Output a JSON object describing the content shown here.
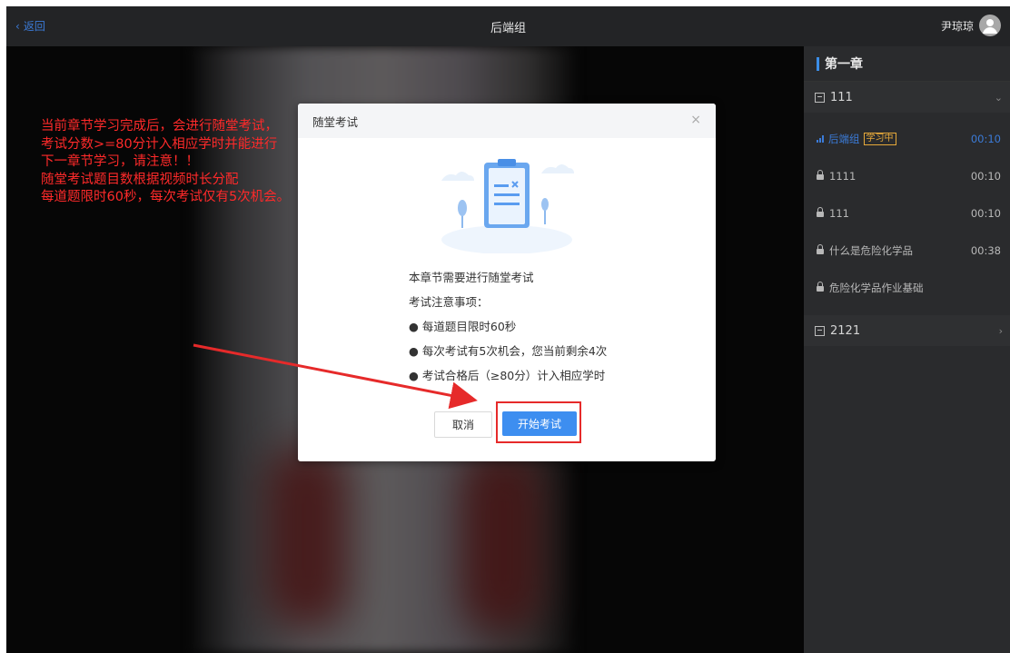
{
  "topbar": {
    "back_label": "返回",
    "title": "后端组",
    "user_name": "尹琼琼"
  },
  "annotation": {
    "lines": [
      "当前章节学习完成后，会进行随堂考试，",
      "考试分数>=80分计入相应学时并能进行",
      "下一章节学习，请注意！！",
      "随堂考试题目数根据视频时长分配",
      "每道题限时60秒，每次考试仅有5次机会。"
    ],
    "color": "#ff2a2a"
  },
  "sidebar": {
    "chapter_title": "第一章",
    "sections": [
      {
        "label": "111",
        "expanded": true
      },
      {
        "label": "2121",
        "expanded": false
      }
    ],
    "lessons": [
      {
        "title": "后端组",
        "tag": "学习中",
        "time": "00:10",
        "active": true
      },
      {
        "title": "1111",
        "time": "00:10",
        "locked": true
      },
      {
        "title": "111",
        "time": "00:10",
        "locked": true
      },
      {
        "title": "什么是危险化学品",
        "time": "00:38",
        "locked": true
      },
      {
        "title": "危险化学品作业基础",
        "time": "",
        "locked": true
      }
    ]
  },
  "dialog": {
    "title": "随堂考试",
    "close_icon": "×",
    "intro": "本章节需要进行随堂考试",
    "notes_title": "考试注意事项：",
    "notes": [
      "● 每道题目限时60秒",
      "● 每次考试有5次机会，您当前剩余4次",
      "● 考试合格后（≥80分）计入相应学时"
    ],
    "cancel_label": "取消",
    "start_label": "开始考试"
  },
  "colors": {
    "accent": "#3d8ef0",
    "annotation_red": "#e62a2a",
    "tag_orange": "#e6a93a"
  }
}
